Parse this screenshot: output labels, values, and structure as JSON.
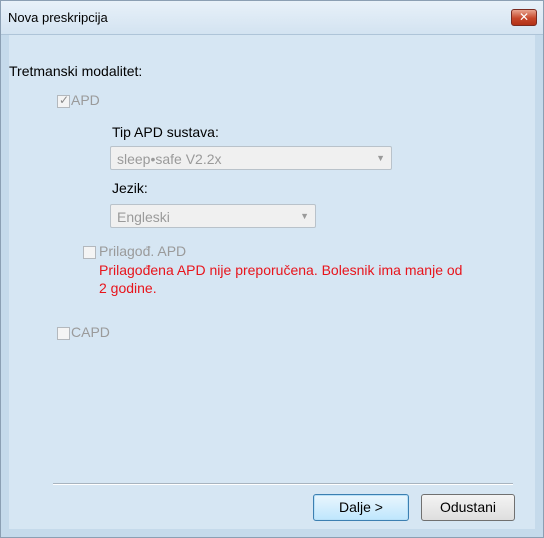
{
  "window": {
    "title": "Nova preskripcija",
    "close_glyph": "✕"
  },
  "form": {
    "treatment_label": "Tretmanski modalitet:",
    "apd": {
      "label": "APD",
      "checked": true,
      "enabled": false
    },
    "apd_system": {
      "label": "Tip APD sustava:",
      "value": "sleep•safe V2.2x"
    },
    "language": {
      "label": "Jezik:",
      "value": "Engleski"
    },
    "custom_apd": {
      "label": "Prilagođ. APD",
      "checked": false,
      "warning_line1": "Prilagođena APD nije preporučena. Bolesnik ima manje od",
      "warning_line2": "2 godine."
    },
    "capd": {
      "label": "CAPD",
      "checked": false
    }
  },
  "buttons": {
    "next": "Dalje >",
    "cancel": "Odustani"
  },
  "colors": {
    "warning": "#e8141b",
    "dialog_bg": "#d6e6f3",
    "disabled_text": "#9a9a9a"
  },
  "icons": {
    "check": "✓",
    "dropdown": "▼"
  }
}
